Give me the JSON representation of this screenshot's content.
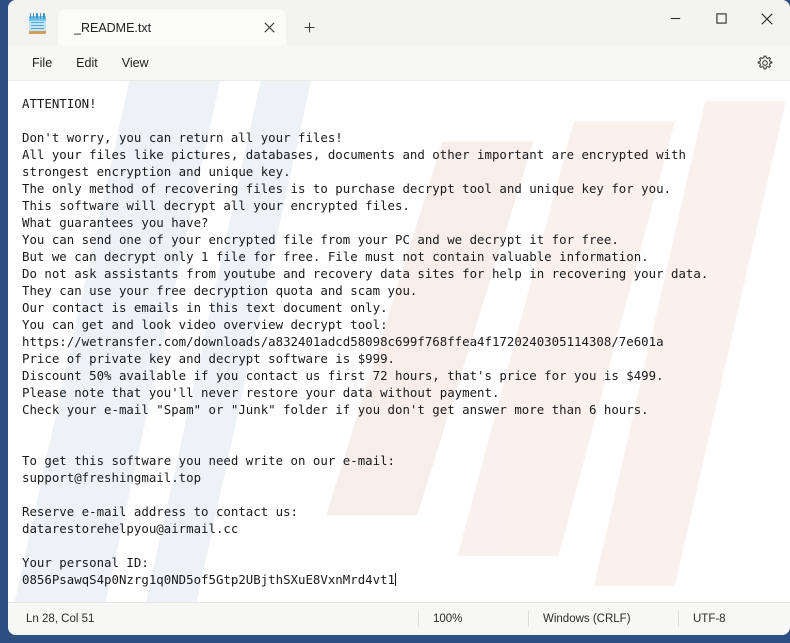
{
  "window": {
    "app_icon": "notepad-icon",
    "minimize_label": "–",
    "maximize_label": "□",
    "close_label": "✕",
    "new_tab_label": "+",
    "tab_close_label": "✕"
  },
  "tabs": [
    {
      "label": "_README.txt",
      "active": true
    }
  ],
  "menu": {
    "items": [
      {
        "label": "File"
      },
      {
        "label": "Edit"
      },
      {
        "label": "View"
      }
    ],
    "settings_icon": "gear-icon"
  },
  "document": {
    "filename": "_README.txt",
    "content": "ATTENTION!\n\nDon't worry, you can return all your files!\nAll your files like pictures, databases, documents and other important are encrypted with\nstrongest encryption and unique key.\nThe only method of recovering files is to purchase decrypt tool and unique key for you.\nThis software will decrypt all your encrypted files.\nWhat guarantees you have?\nYou can send one of your encrypted file from your PC and we decrypt it for free.\nBut we can decrypt only 1 file for free. File must not contain valuable information.\nDo not ask assistants from youtube and recovery data sites for help in recovering your data.\nThey can use your free decryption quota and scam you.\nOur contact is emails in this text document only.\nYou can get and look video overview decrypt tool:\nhttps://wetransfer.com/downloads/a832401adcd58098c699f768ffea4f1720240305114308/7e601a\nPrice of private key and decrypt software is $999.\nDiscount 50% available if you contact us first 72 hours, that's price for you is $499.\nPlease note that you'll never restore your data without payment.\nCheck your e-mail \"Spam\" or \"Junk\" folder if you don't get answer more than 6 hours.\n\n\nTo get this software you need write on our e-mail:\nsupport@freshingmail.top\n\nReserve e-mail address to contact us:\ndatarestorehelpyou@airmail.cc\n\nYour personal ID:\n0856PsawqS4p0Nzrg1q0ND5of5Gtp2UBjthSXuE8VxnMrd4vt1",
    "contact_email_primary": "support@freshingmail.top",
    "contact_email_reserve": "datarestorehelpyou@airmail.cc",
    "video_url": "https://wetransfer.com/downloads/a832401adcd58098c699f768ffea4f1720240305114308/7e601a",
    "price_full": "$999",
    "price_discounted": "$499",
    "discount_percent": "50%",
    "discount_window_hours": "72 hours",
    "answer_window_hours": "6 hours",
    "personal_id": "0856PsawqS4p0Nzrg1q0ND5of5Gtp2UBjthSXuE8VxnMrd4vt1"
  },
  "statusbar": {
    "cursor_position": "Ln 28, Col 51",
    "zoom": "100%",
    "line_endings": "Windows (CRLF)",
    "encoding": "UTF-8"
  },
  "colors": {
    "frame_blue": "#2d4f82",
    "window_bg": "#f7f7f5",
    "editor_bg": "#ffffff",
    "text": "#1a1a1a"
  }
}
